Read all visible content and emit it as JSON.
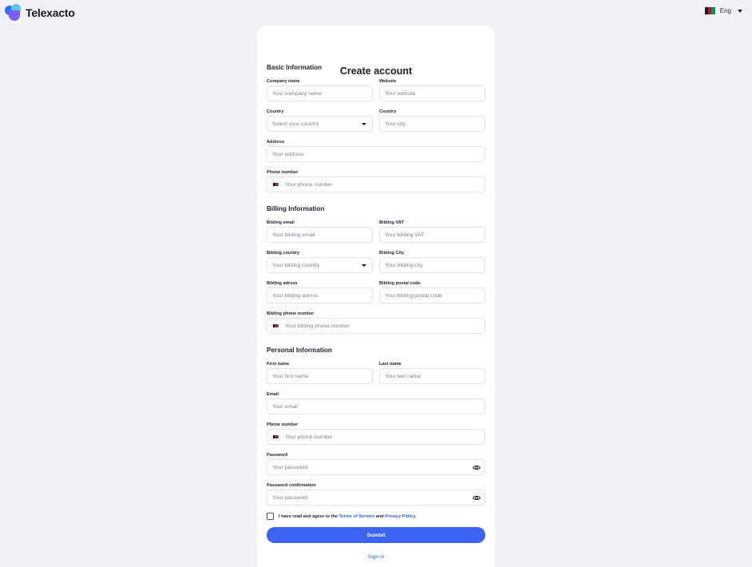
{
  "brand": {
    "name": "Telexacto",
    "logo_icon": "telexacto-logo-icon"
  },
  "language": {
    "label": "Eng",
    "flag": {
      "colors": [
        "#1a1a1a",
        "#c8102e",
        "#009a44"
      ]
    }
  },
  "form": {
    "title": "Create account",
    "sections": {
      "basic": {
        "title": "Basic Information",
        "company_name": {
          "label": "Company name",
          "placeholder": "Your company name"
        },
        "website": {
          "label": "Website",
          "placeholder": "Your website"
        },
        "country": {
          "label": "Country",
          "placeholder": "Select your country"
        },
        "city": {
          "label": "Country",
          "placeholder": "Your city"
        },
        "address": {
          "label": "Address",
          "placeholder": "Your address"
        },
        "phone": {
          "label": "Phone number",
          "placeholder": "Your phone number"
        }
      },
      "billing": {
        "title": "Billing Information",
        "email": {
          "label": "Bilding email",
          "placeholder": "Your bilding email"
        },
        "vat": {
          "label": "Bilding VAT",
          "placeholder": "Your bilding VAT"
        },
        "country": {
          "label": "Bilding country",
          "placeholder": "Your bilding country"
        },
        "city": {
          "label": "Bilding City",
          "placeholder": "Your bilding city"
        },
        "address": {
          "label": "Bilding adress",
          "placeholder": "Your bilding adress"
        },
        "postal": {
          "label": "Bilding postal code",
          "placeholder": "Your bilding postal code"
        },
        "phone": {
          "label": "Bilding phone number",
          "placeholder": "Your bilding phone number"
        }
      },
      "personal": {
        "title": "Personal Information",
        "first_name": {
          "label": "First name",
          "placeholder": "Your first name"
        },
        "last_name": {
          "label": "Last name",
          "placeholder": "Your last name"
        },
        "email": {
          "label": "Email",
          "placeholder": "Your email"
        },
        "phone": {
          "label": "Phone number",
          "placeholder": "Your phone number"
        },
        "password": {
          "label": "Password",
          "placeholder": "Your password"
        },
        "password_confirm": {
          "label": "Password confirmation",
          "placeholder": "Your password"
        }
      }
    },
    "agree": {
      "prefix": "I have read and agree to the ",
      "terms": "Terms of Service",
      "and": " and ",
      "privacy": "Privacy Policy",
      "suffix": "."
    },
    "submit_label": "Sumbit",
    "signin_label": "Sign in"
  }
}
